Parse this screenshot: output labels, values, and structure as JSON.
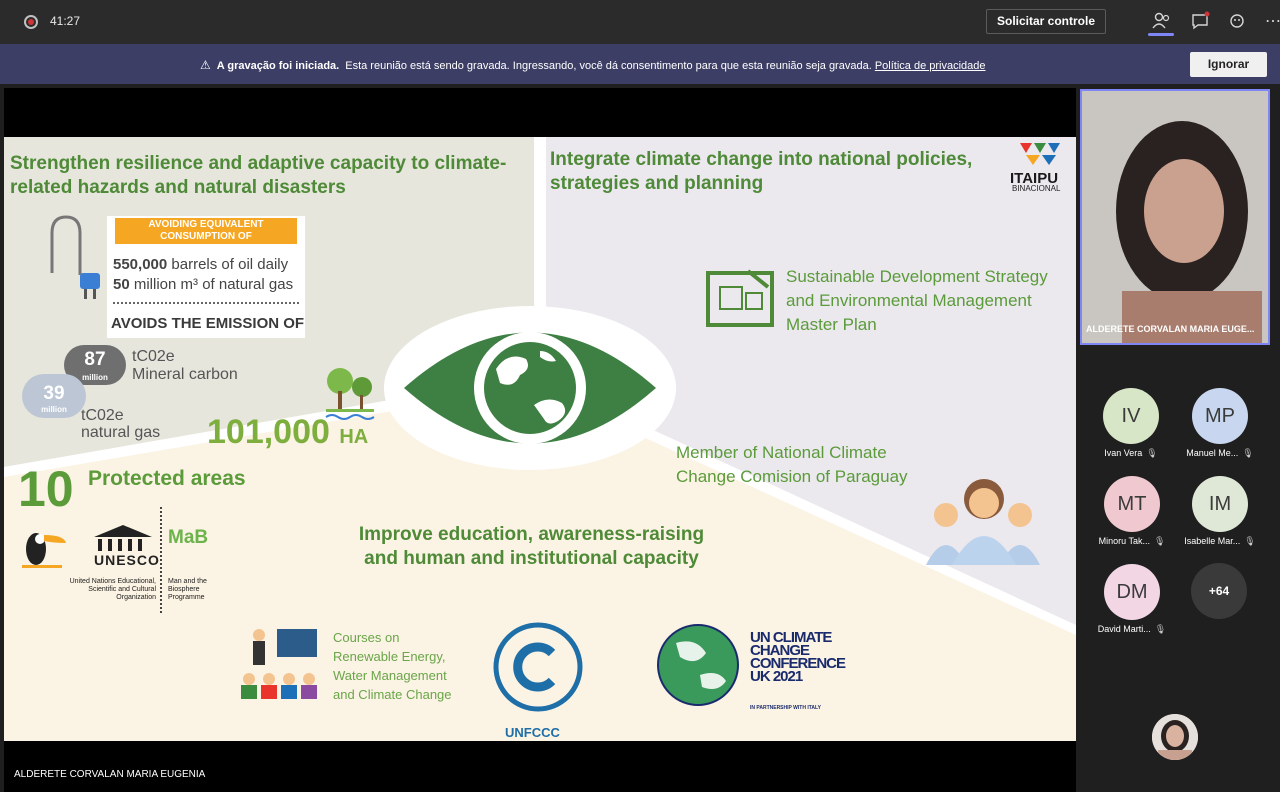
{
  "topbar": {
    "timer": "41:27",
    "control_button": "Solicitar controle"
  },
  "recording_notice": {
    "bold": "A gravação foi iniciada.",
    "text": "Esta reunião está sendo gravada. Ingressando, você dá consentimento para que esta reunião seja gravada.",
    "link": "Política de privacidade",
    "dismiss_button": "Ignorar"
  },
  "slide": {
    "left_title": "Strengthen resilience and adaptive capacity to climate-related hazards and natural disasters",
    "right_title": "Integrate climate change into national policies, strategies and planning",
    "bottom_title": "Improve education, awareness-raising and human and institutional capacity",
    "banner_top": "AVOIDING EQUIVALENT CONSUMPTION OF",
    "oil_value": "550,000",
    "oil_text": "barrels of oil daily",
    "gas_value": "50",
    "gas_text": "million m³ of natural gas",
    "avoids_text": "AVOIDS THE EMISSION OF",
    "carbon_value": "87",
    "carbon_mult": "million",
    "carbon_unit": "tC02e",
    "carbon_label": "Mineral carbon",
    "ng_value": "39",
    "ng_mult": "million",
    "ng_unit": "tC02e",
    "ng_label": "natural gas",
    "ha_value": "101,000",
    "ha_unit": "HA",
    "protected_count": "10",
    "protected_label": "Protected areas",
    "unesco_word": "UNESCO",
    "unesco_caption": "United Nations Educational, Scientific and Cultural Organization",
    "mab_word": "MaB",
    "mab_caption": "Man and the Biosphere Programme",
    "strategy_text": "Sustainable Development Strategy and Environmental Management Master Plan",
    "member_text": "Member of National Climate Change Comision of Paraguay",
    "itaipu": "ITAIPU",
    "itaipu_sub": "BINACIONAL",
    "courses_text": "Courses on Renewable Energy, Water Management and Climate Change",
    "unfccc": "UNFCCC",
    "ukcc": "UN CLIMATE CHANGE CONFERENCE UK 2021",
    "ukcc_sub": "IN PARTNERSHIP WITH ITALY"
  },
  "presenter_name": "ALDERETE CORVALAN MARIA EUGENIA",
  "video_tile_name": "ALDERETE CORVALAN MARIA EUGE...",
  "participants": [
    {
      "initials": "IV",
      "name": "Ivan Vera",
      "color": "#d8e6c8"
    },
    {
      "initials": "MP",
      "name": "Manuel Me...",
      "color": "#c8d7ef"
    },
    {
      "initials": "MT",
      "name": "Minoru Tak...",
      "color": "#f0c8cf"
    },
    {
      "initials": "IM",
      "name": "Isabelle Mar...",
      "color": "#dfe8d7"
    },
    {
      "initials": "DM",
      "name": "David Marti...",
      "color": "#f2d6e4"
    }
  ],
  "more_count": "+64"
}
